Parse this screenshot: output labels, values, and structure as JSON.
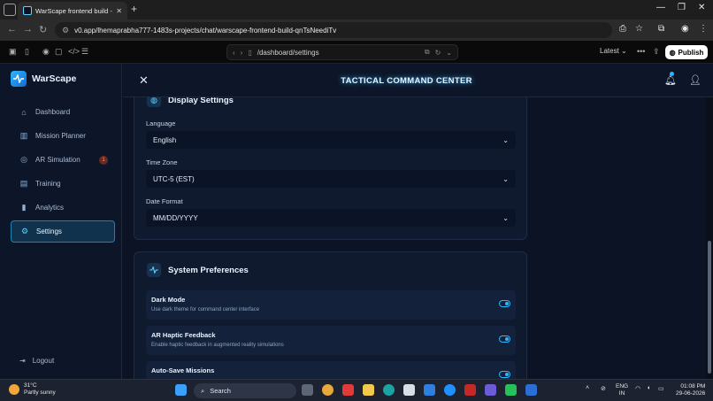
{
  "browser": {
    "tab_title": "WarScape frontend build - v0 b",
    "url": "v0.app/lhemaprabha777-1483s-projects/chat/warscape-frontend-build-qnTsNeediTv"
  },
  "v0_toolbar": {
    "path": "/dashboard/settings",
    "version_label": "Latest",
    "publish_label": "Publish"
  },
  "app": {
    "brand": "WarScape",
    "header_title": "TACTICAL COMMAND CENTER",
    "nav": [
      {
        "label": "Dashboard",
        "icon": "home-icon"
      },
      {
        "label": "Mission Planner",
        "icon": "map-icon"
      },
      {
        "label": "AR Simulation",
        "icon": "target-icon",
        "badge": "1"
      },
      {
        "label": "Training",
        "icon": "book-icon"
      },
      {
        "label": "Analytics",
        "icon": "bar-chart-icon"
      },
      {
        "label": "Settings",
        "icon": "gear-icon",
        "active": true
      }
    ],
    "logout_label": "Logout"
  },
  "display_settings": {
    "title": "Display Settings",
    "language_label": "Language",
    "language_value": "English",
    "timezone_label": "Time Zone",
    "timezone_value": "UTC-5 (EST)",
    "date_format_label": "Date Format",
    "date_format_value": "MM/DD/YYYY"
  },
  "system_preferences": {
    "title": "System Preferences",
    "items": [
      {
        "title": "Dark Mode",
        "desc": "Use dark theme for command center interface",
        "enabled": true
      },
      {
        "title": "AR Haptic Feedback",
        "desc": "Enable haptic feedback in augmented reality simulations",
        "enabled": true
      },
      {
        "title": "Auto-Save Missions",
        "desc": "",
        "enabled": true
      }
    ]
  },
  "taskbar": {
    "weather_temp": "31°C",
    "weather_desc": "Partly sunny",
    "search_label": "Search",
    "lang_top": "ENG",
    "lang_bottom": "IN",
    "time": "01:08 PM",
    "date": "29-06-2026"
  },
  "colors": {
    "accent": "#2bb8ff",
    "background": "#0b1324",
    "card": "#0f1a2e"
  }
}
